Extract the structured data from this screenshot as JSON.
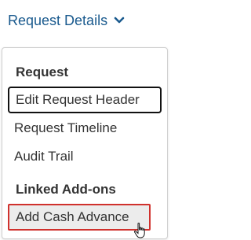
{
  "trigger": {
    "label": "Request Details",
    "icon": "chevron-down-icon"
  },
  "menu": {
    "section_request": "Request",
    "items_request": [
      "Edit Request Header",
      "Request Timeline",
      "Audit Trail"
    ],
    "section_addons": "Linked Add-ons",
    "items_addons": [
      "Add Cash Advance"
    ]
  },
  "colors": {
    "link": "#1a5a8e",
    "focus_border": "#111111",
    "hover_border": "#d0312d"
  }
}
